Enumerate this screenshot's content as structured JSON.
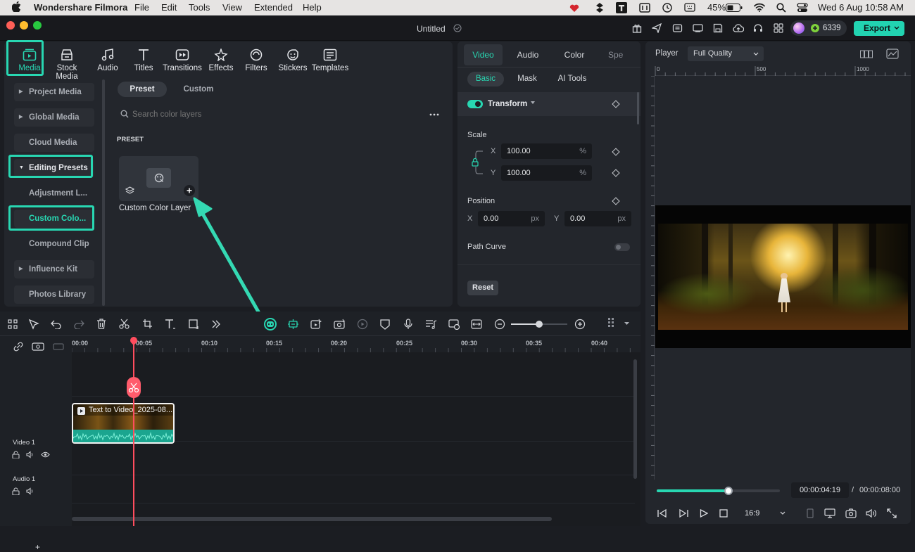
{
  "menubar": {
    "app_name": "Wondershare Filmora",
    "items": [
      "File",
      "Edit",
      "Tools",
      "View",
      "Extended",
      "Help"
    ],
    "battery": "45%",
    "datetime": "Wed 6 Aug  10:58 AM"
  },
  "titlebar": {
    "project_title": "Untitled",
    "credits": "6339",
    "export_label": "Export"
  },
  "toolbar": {
    "items": [
      {
        "label": "Media",
        "icon": "media-icon"
      },
      {
        "label": "Stock Media",
        "icon": "stock-media-icon"
      },
      {
        "label": "Audio",
        "icon": "music-note-icon"
      },
      {
        "label": "Titles",
        "icon": "text-t-icon"
      },
      {
        "label": "Transitions",
        "icon": "transitions-icon"
      },
      {
        "label": "Effects",
        "icon": "sparkle-icon"
      },
      {
        "label": "Filters",
        "icon": "filter-icon"
      },
      {
        "label": "Stickers",
        "icon": "sticker-icon"
      },
      {
        "label": "Templates",
        "icon": "templates-icon"
      }
    ]
  },
  "sidebar": {
    "items": [
      {
        "label": "Project Media"
      },
      {
        "label": "Global Media"
      },
      {
        "label": "Cloud Media"
      },
      {
        "label": "Editing Presets"
      },
      {
        "label": "Adjustment L..."
      },
      {
        "label": "Custom Colo..."
      },
      {
        "label": "Compound Clip"
      },
      {
        "label": "Influence Kit"
      },
      {
        "label": "Photos Library"
      }
    ]
  },
  "media": {
    "tabs": [
      "Preset",
      "Custom"
    ],
    "search_placeholder": "Search color layers",
    "section_label": "PRESET",
    "tile_label": "Custom Color Layer"
  },
  "properties": {
    "tabs": [
      "Video",
      "Audio",
      "Color",
      "Spe"
    ],
    "subtabs": [
      "Basic",
      "Mask",
      "AI Tools"
    ],
    "transform_label": "Transform",
    "scale_label": "Scale",
    "scale_x": "100.00",
    "scale_y": "100.00",
    "scale_unit": "%",
    "position_label": "Position",
    "pos_x": "0.00",
    "pos_y": "0.00",
    "pos_unit": "px",
    "x_label": "X",
    "y_label": "Y",
    "path_curve_label": "Path Curve",
    "reset_label": "Reset"
  },
  "player": {
    "label": "Player",
    "quality": "Full Quality",
    "ruler_ticks": [
      "0",
      "500",
      "1000"
    ],
    "current_time": "00:00:04:19",
    "separator": "/",
    "total_time": "00:00:08:00",
    "aspect": "16:9",
    "progress": 0.58
  },
  "timeline": {
    "ticks": [
      "00:00",
      "00:05",
      "00:10",
      "00:15",
      "00:20",
      "00:25",
      "00:30",
      "00:35",
      "00:40"
    ],
    "video_track": "Video 1",
    "audio_track": "Audio 1",
    "clip_title": "Text to Video_2025-08..."
  },
  "colors": {
    "accent": "#28d7b2",
    "playhead": "#ff4d5e",
    "panel": "#23262c",
    "background": "#1b1d22"
  }
}
